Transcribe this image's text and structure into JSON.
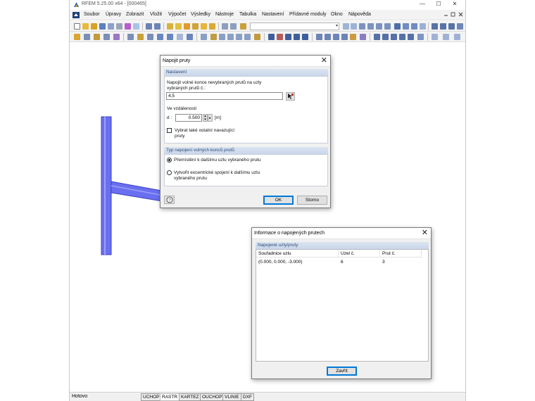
{
  "window": {
    "title": "RFEM 5.25.00 x64 - [000465]",
    "controls": [
      "—",
      "☐",
      "✕"
    ]
  },
  "menu": {
    "items": [
      "Soubor",
      "Úpravy",
      "Zobrazit",
      "Vložit",
      "Výpočet",
      "Výsledky",
      "Nástroje",
      "Tabulka",
      "Nastavení",
      "Přídavné moduly",
      "Okno",
      "Nápověda"
    ]
  },
  "status": {
    "text": "Hotovo",
    "buttons": [
      "UCHOP",
      "RASTR",
      "KARTEZ",
      "OUCHOP",
      "VLINIE",
      "DXF"
    ]
  },
  "dialog_connect": {
    "title": "Napojit pruty",
    "section_settings": "Nastavení",
    "prompt": "Napojit volné konce nevybraných prutů na uzly vybraných prutů č.:",
    "members_value": "4,5",
    "distance_heading": "Ve vzdálenosti",
    "distance_label": "d :",
    "distance_value": "0.500",
    "distance_unit": "[m]",
    "also_select_label": "Vybrat také ostatní navazující pruty",
    "section_type": "Typ napojení volných konců prutů",
    "option_move": "Přemístění k dalšímu uzlu vybraného prutu",
    "option_eccentric": "Vytvořit excentrické spojení k dalšímu uzlu vybraného prutu",
    "ok": "OK",
    "cancel": "Storno"
  },
  "dialog_info": {
    "title": "Informace o napojených prutech",
    "section": "Napojené uzly/pruty",
    "columns": [
      "Souřadnice uzlu",
      "Uzel č.",
      "Prut č."
    ],
    "rows": [
      [
        "(0.000, 0.000, -3.000)",
        "6",
        "3"
      ]
    ],
    "close": "Zavřít"
  },
  "colors": {
    "member": "#6666ee",
    "accent": "#0078d7"
  }
}
